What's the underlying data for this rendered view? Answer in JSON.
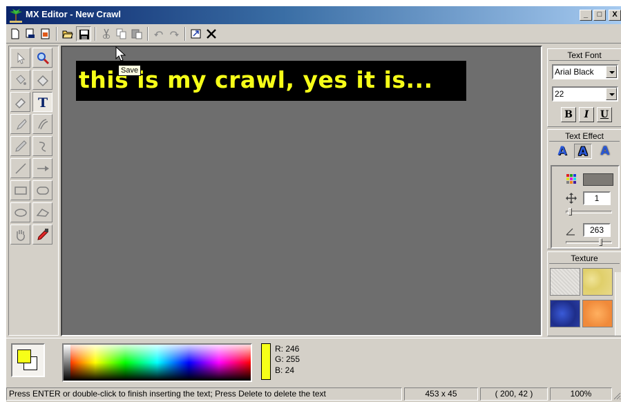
{
  "window": {
    "title": "MX Editor - New Crawl",
    "buttons": {
      "minimize": "_",
      "maximize": "□",
      "close": "X"
    }
  },
  "toolbar": {
    "buttons": [
      "new",
      "print-preview",
      "import",
      "open",
      "save",
      "cut",
      "copy",
      "paste",
      "undo",
      "redo",
      "resize",
      "delete"
    ],
    "tooltip": "Save"
  },
  "tools": [
    "select",
    "zoom",
    "fill",
    "eraser-bucket",
    "eraser",
    "text",
    "brush",
    "spray",
    "pen",
    "lasso-curve",
    "line",
    "arrow",
    "rectangle",
    "rounded-rectangle",
    "ellipse",
    "polygon",
    "hand",
    "color-picker"
  ],
  "canvas": {
    "text": "this is my crawl, yes it is...",
    "text_color": "#f6ff18",
    "background": "#000000",
    "area_color": "#6e6e6e"
  },
  "text_font": {
    "header": "Text Font",
    "font_name": "Arial Black",
    "font_size": "22",
    "bold": "B",
    "italic": "I",
    "underline": "U"
  },
  "text_effect": {
    "header": "Text Effect",
    "effect_glyph": "A",
    "shadow_color": "#7d7a75",
    "offset_value": "1",
    "angle_value": "263"
  },
  "texture": {
    "header": "Texture",
    "swatches": [
      "#e2e0dc",
      "#e6d77a",
      "#2740a8",
      "#f79a45"
    ]
  },
  "color_panel": {
    "foreground": "#f6ff18",
    "background": "#ffffff",
    "r": "R: 246",
    "g": "G: 255",
    "b": "B: 24"
  },
  "status": {
    "message": "Press ENTER or double-click to finish inserting the text; Press Delete to delete the text",
    "size": "453 x 45",
    "position": "( 200, 42 )",
    "zoom": "100%"
  }
}
